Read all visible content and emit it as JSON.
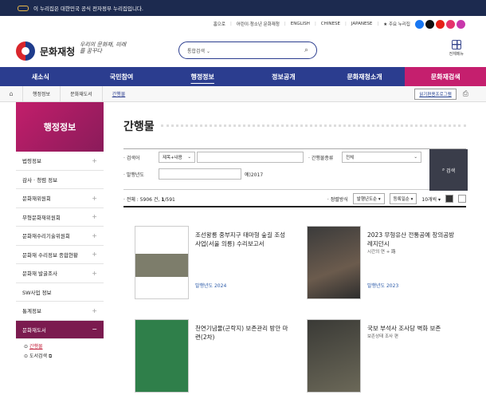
{
  "gov_banner": {
    "text": "이 누리집은 대한민국 공식 전자정부 누리집입니다."
  },
  "util_links": [
    "홈으로",
    "어린이·청소년 문화재청",
    "ENGLISH",
    "CHINESE",
    "JAPANESE",
    "주요 누리집"
  ],
  "brand": {
    "name": "문화재청",
    "slogan": "우리의 문화재, 미래를 꿈꾸다"
  },
  "search": {
    "placeholder": "통합검색"
  },
  "sitemap": {
    "label": "전체메뉴"
  },
  "gnb": [
    "새소식",
    "국민참여",
    "행정정보",
    "정보공개",
    "문화재청소개",
    "문화재검색"
  ],
  "breadcrumb": {
    "items": [
      "행정정보",
      "문화재도서",
      "간행물"
    ],
    "guide_button": "읽기편용프로그램"
  },
  "lnb": {
    "title": "행정정보",
    "items": [
      "법령정보",
      "감사 · 청렴 정보",
      "문화재위원회",
      "무형문화재위원회",
      "문화재수리기술위원회",
      "문화재 수리정보 종합현황",
      "문화재 발굴조사",
      "SW사업 정보",
      "통계정보",
      "문화재도서"
    ],
    "sub": [
      "간행물",
      "도서검색"
    ]
  },
  "page": {
    "title": "간행물"
  },
  "form": {
    "keyword_label": "· 검색어",
    "keyword_select": "제목+내용",
    "type_label": "· 간행물종류",
    "type_select": "전체",
    "year_label": "· 발행년도",
    "year_suffix": "예)2017",
    "search_button": "검색"
  },
  "result": {
    "total_label": "· 전체 : 5906 건, ",
    "page": "1",
    "pages": "/591",
    "sort_label": "· 정렬방식",
    "sort1": "발행년도순",
    "sort2": "등록일순",
    "perpage": "10개씩"
  },
  "cards": [
    {
      "title": "조선왕릉 중부지구 태마형 숲길 조성사업(서울 의릉) 수리보고서",
      "sub": "",
      "year": "발행년도 2024"
    },
    {
      "title": "2023 무형유산 전통공예 창의공방 레지던시",
      "sub": "시간의 연 + 路",
      "year": "발행년도 2023"
    },
    {
      "title": "천연기념물(군락지) 보존관리 방안 마련(2차)",
      "sub": "",
      "year": ""
    },
    {
      "title": "국보 부석사 조사당 벽화 보존",
      "sub": "보존상태 조사 편",
      "year": ""
    }
  ],
  "colors": {
    "navy": "#2b3d8f",
    "magenta": "#c21e6b"
  }
}
